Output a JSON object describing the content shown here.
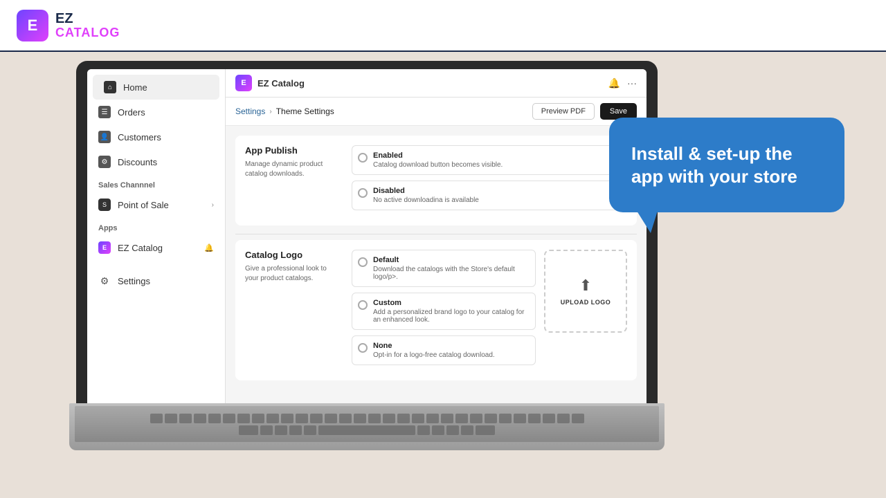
{
  "topbar": {
    "logo_letter": "E",
    "logo_ez": "EZ",
    "logo_catalog": "CATALOG"
  },
  "sidebar": {
    "items": [
      {
        "id": "home",
        "label": "Home",
        "icon": "house"
      },
      {
        "id": "orders",
        "label": "Orders",
        "icon": "box"
      },
      {
        "id": "customers",
        "label": "Customers",
        "icon": "person"
      },
      {
        "id": "discounts",
        "label": "Discounts",
        "icon": "tag"
      }
    ],
    "sales_channel_label": "Sales Channnel",
    "sales_channel_items": [
      {
        "id": "pos",
        "label": "Point of Sale",
        "icon": "shopify"
      }
    ],
    "apps_label": "Apps",
    "apps_items": [
      {
        "id": "ezcatalog",
        "label": "EZ Catalog",
        "icon": "ez"
      }
    ],
    "settings_label": "Settings"
  },
  "app_header": {
    "logo_letter": "E",
    "title": "EZ Catalog"
  },
  "breadcrumb": {
    "settings": "Settings",
    "current": "Theme Settings",
    "preview_btn": "Preview PDF",
    "save_btn": "Save"
  },
  "app_publish": {
    "title": "App Publish",
    "description": "Manage dynamic product catalog downloads.",
    "options": [
      {
        "id": "enabled",
        "label": "Enabled",
        "sub": "Catalog download button becomes visible."
      },
      {
        "id": "disabled",
        "label": "Disabled",
        "sub": "No active downloadina is available"
      }
    ]
  },
  "catalog_logo": {
    "title": "Catalog Logo",
    "description": "Give a professional look to your product catalogs.",
    "options": [
      {
        "id": "default",
        "label": "Default",
        "sub": "Download the catalogs with the Store's default logo/p>."
      },
      {
        "id": "custom",
        "label": "Custom",
        "sub": "Add a personalized brand logo to your catalog for an enhanced look."
      },
      {
        "id": "none",
        "label": "None",
        "sub": "Opt-in for a logo-free catalog download."
      }
    ],
    "upload_label": "UPLOAD LOGO"
  },
  "speech_bubble": {
    "text": "Install & set-up the app with your store"
  }
}
